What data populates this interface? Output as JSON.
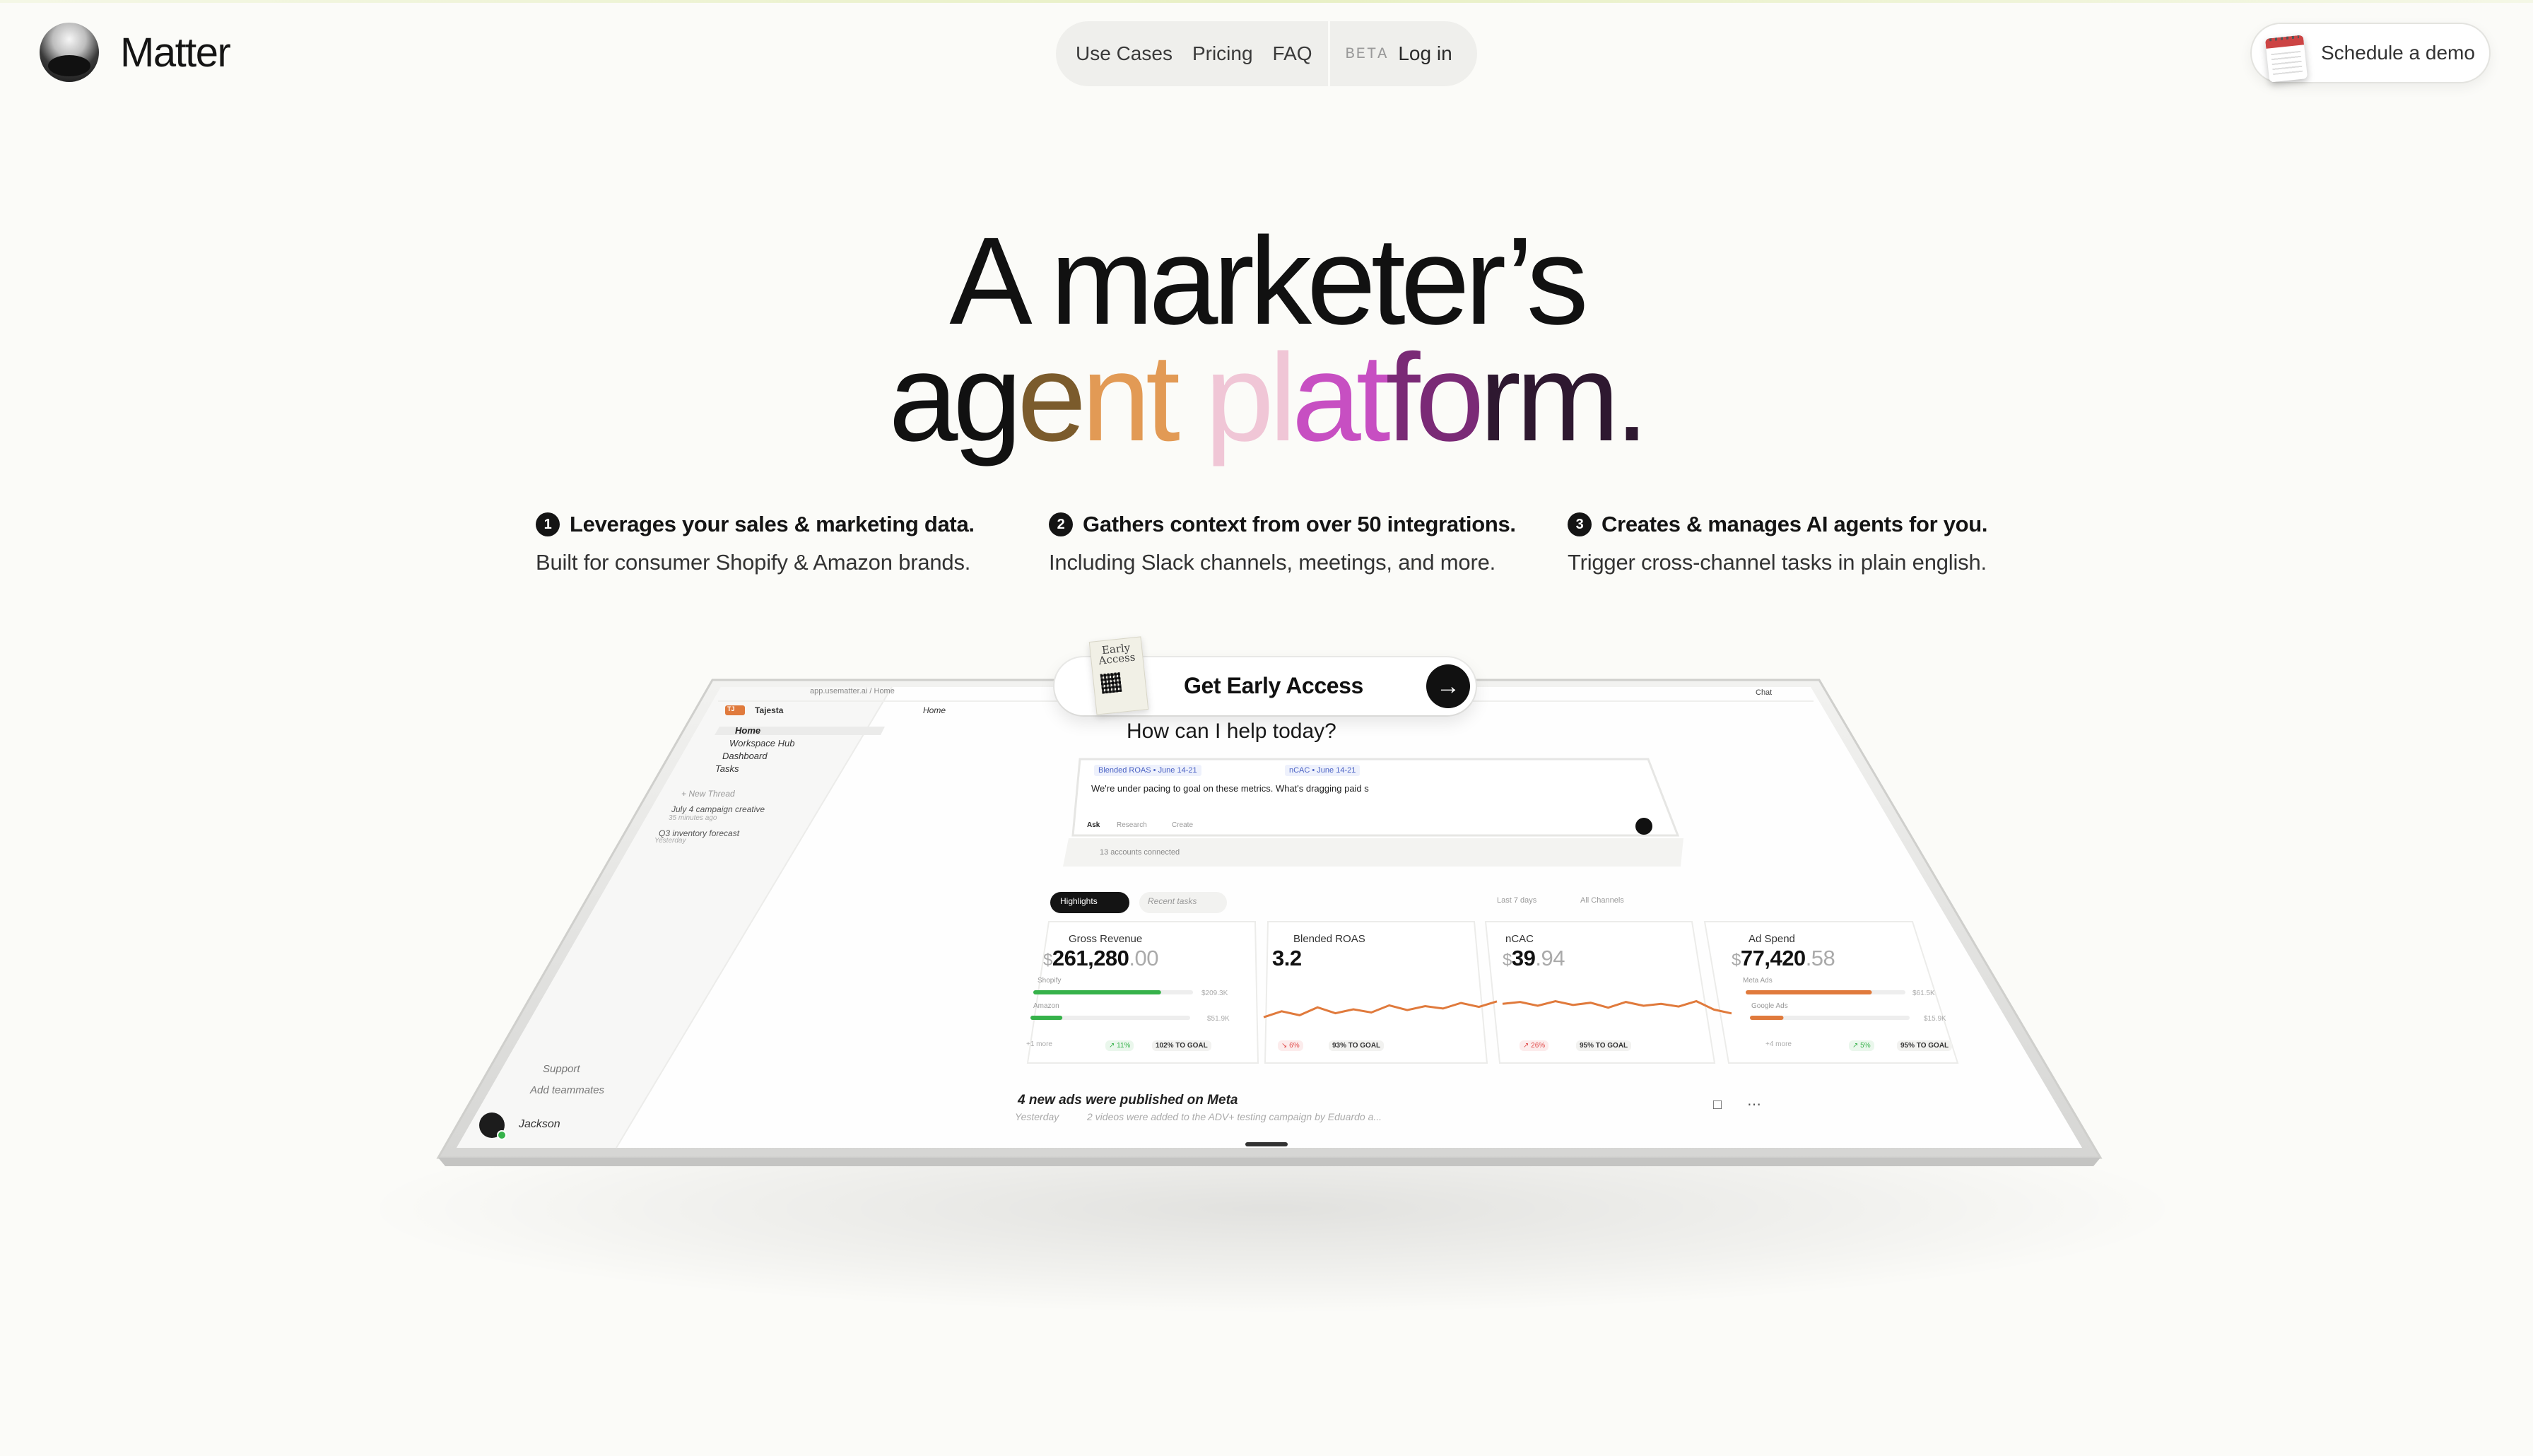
{
  "brand": {
    "name": "Matter"
  },
  "nav": {
    "items": [
      "Use Cases",
      "Pricing",
      "FAQ"
    ],
    "beta": "BETA",
    "login": "Log in"
  },
  "demo": {
    "label": "Schedule a demo"
  },
  "hero": {
    "line1": "A marketer’s",
    "line2_parts": [
      "ag",
      "e",
      "nt",
      " ",
      "pl",
      "at",
      "fo",
      "rm."
    ]
  },
  "features": [
    {
      "num": "1",
      "title": "Leverages your sales & marketing data.",
      "sub": "Built for consumer Shopify & Amazon brands."
    },
    {
      "num": "2",
      "title": "Gathers context from over 50 integrations.",
      "sub": "Including Slack channels, meetings, and more."
    },
    {
      "num": "3",
      "title": "Creates & manages AI agents for you.",
      "sub": "Trigger cross-channel tasks in plain english."
    }
  ],
  "cta": {
    "label": "Get Early Access",
    "ticket": "Early Access",
    "arrow": "→"
  },
  "app": {
    "url": "app.usematter.ai / Home",
    "chat_button": "Chat",
    "workspace": "Tajesta",
    "workspace_badge": "TJ",
    "breadcrumb": "Home",
    "sidebar": [
      "Home",
      "Workspace Hub",
      "Dashboard",
      "Tasks"
    ],
    "new_thread": "+ New Thread",
    "threads": [
      {
        "title": "July 4 campaign creative",
        "time": "35 minutes ago"
      },
      {
        "title": "Q3 inventory forecast",
        "time": "Yesterday"
      }
    ],
    "support": "Support",
    "add_teammates": "Add teammates",
    "user": "Jackson",
    "prompt_heading": "How can I help today?",
    "chips": [
      "Blended ROAS • June 14-21",
      "nCAC • June 14-21"
    ],
    "prompt_text": "We're under pacing to goal on these metrics. What's dragging paid s",
    "modes": [
      "Ask",
      "Research",
      "Create"
    ],
    "accounts": "13 accounts connected",
    "tabs": [
      "Highlights",
      "Recent tasks"
    ],
    "filters": [
      "Last 7 days",
      "All Channels"
    ],
    "metrics": [
      {
        "title": "Gross Revenue",
        "currency": "$",
        "value": "261,280",
        "decimals": ".00",
        "rows": [
          {
            "label": "Shopify",
            "value": "$209.3K"
          },
          {
            "label": "Amazon",
            "value": "$51.9K"
          }
        ],
        "more": "+1 more",
        "change": "↗ 11%",
        "goal": "102% TO GOAL"
      },
      {
        "title": "Blended ROAS",
        "currency": "",
        "value": "3.2",
        "decimals": "",
        "trend": [
          0.3,
          0.45,
          0.35,
          0.55,
          0.4,
          0.5,
          0.42,
          0.6,
          0.48,
          0.58,
          0.52,
          0.66,
          0.56,
          0.7
        ],
        "change": "↘ 6%",
        "goal": "93% TO GOAL"
      },
      {
        "title": "nCAC",
        "currency": "$",
        "value": "39",
        "decimals": ".94",
        "trend": [
          0.55,
          0.6,
          0.5,
          0.62,
          0.52,
          0.58,
          0.45,
          0.6,
          0.5,
          0.55,
          0.48,
          0.62,
          0.4,
          0.3
        ],
        "change": "↗ 26%",
        "goal": "95% TO GOAL"
      },
      {
        "title": "Ad Spend",
        "currency": "$",
        "value": "77,420",
        "decimals": ".58",
        "rows": [
          {
            "label": "Meta Ads",
            "value": "$61.5K"
          },
          {
            "label": "Google Ads",
            "value": "$15.9K"
          }
        ],
        "more": "+4 more",
        "change": "↗ 5%",
        "goal": "95% TO GOAL"
      }
    ],
    "progress": {
      "shopify": 0.8,
      "amazon": 0.2,
      "meta": 0.79,
      "google": 0.21
    },
    "feed": {
      "title": "4 new ads were published on Meta",
      "time": "Yesterday",
      "desc": "2 videos were added to the ADV+ testing campaign by Eduardo a..."
    },
    "colors": {
      "accent": "#e07a3c",
      "positive": "#36b24a",
      "negative": "#e04848"
    }
  }
}
